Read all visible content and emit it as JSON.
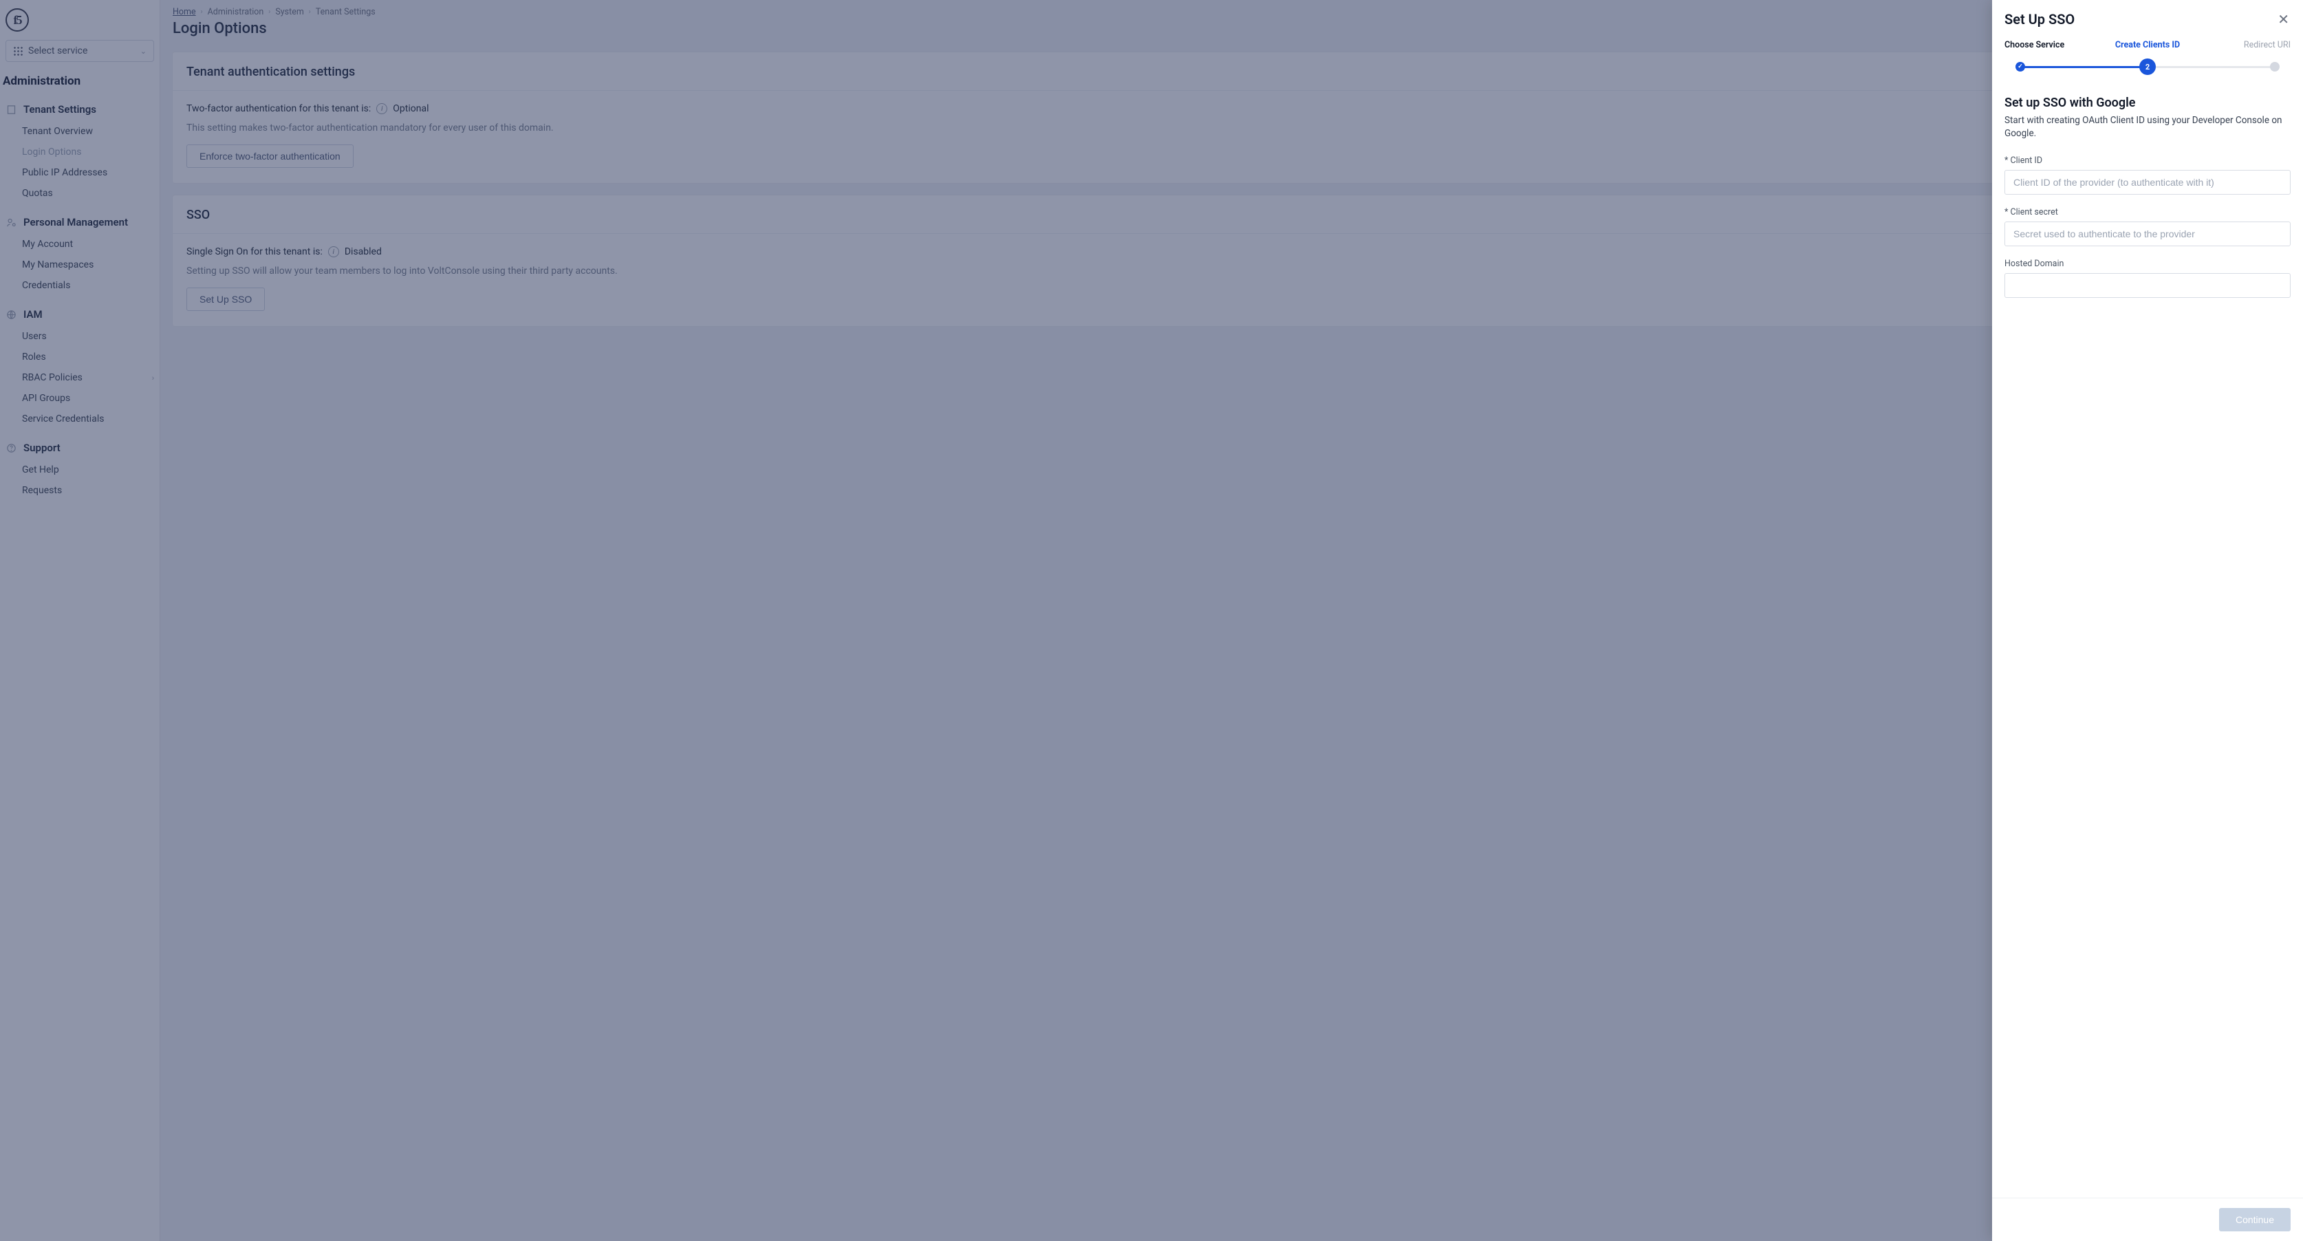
{
  "service_selector": {
    "label": "Select service"
  },
  "section_title": "Administration",
  "sidebar": {
    "groups": [
      {
        "title": "Tenant Settings",
        "icon": "building",
        "items": [
          {
            "label": "Tenant Overview",
            "active": false
          },
          {
            "label": "Login Options",
            "active": true
          },
          {
            "label": "Public IP Addresses",
            "active": false
          },
          {
            "label": "Quotas",
            "active": false
          }
        ]
      },
      {
        "title": "Personal Management",
        "icon": "user-gear",
        "items": [
          {
            "label": "My Account"
          },
          {
            "label": "My Namespaces"
          },
          {
            "label": "Credentials"
          }
        ]
      },
      {
        "title": "IAM",
        "icon": "globe",
        "items": [
          {
            "label": "Users"
          },
          {
            "label": "Roles"
          },
          {
            "label": "RBAC Policies",
            "chevron": true
          },
          {
            "label": "API Groups"
          },
          {
            "label": "Service Credentials"
          }
        ]
      },
      {
        "title": "Support",
        "icon": "help",
        "items": [
          {
            "label": "Get Help"
          },
          {
            "label": "Requests"
          }
        ]
      }
    ]
  },
  "breadcrumbs": [
    {
      "label": "Home",
      "link": true
    },
    {
      "label": "Administration"
    },
    {
      "label": "System"
    },
    {
      "label": "Tenant Settings"
    }
  ],
  "page_title": "Login Options",
  "card1": {
    "title": "Tenant authentication settings",
    "kv_label": "Two-factor authentication for this tenant is:",
    "kv_value": "Optional",
    "desc": "This setting makes two-factor authentication mandatory for every user of this domain.",
    "button": "Enforce two-factor authentication"
  },
  "card2": {
    "title": "SSO",
    "kv_label": "Single Sign On for this tenant is:",
    "kv_value": "Disabled",
    "desc": "Setting up SSO will allow your team members to log into VoltConsole using their third party accounts.",
    "button": "Set Up SSO"
  },
  "drawer": {
    "title": "Set Up SSO",
    "steps": [
      {
        "label": "Choose Service"
      },
      {
        "label": "Create Clients ID"
      },
      {
        "label": "Redirect URI"
      }
    ],
    "current_step_number": "2",
    "form_title": "Set up SSO with Google",
    "form_desc": "Start with creating OAuth Client ID using your Developer Console on Google.",
    "fields": {
      "client_id": {
        "label": "* Client ID",
        "placeholder": "Client ID of the provider (to authenticate with it)"
      },
      "client_secret": {
        "label": "* Client secret",
        "placeholder": "Secret used to authenticate to the provider"
      },
      "hosted_domain": {
        "label": "Hosted Domain",
        "placeholder": ""
      }
    },
    "continue": "Continue"
  }
}
